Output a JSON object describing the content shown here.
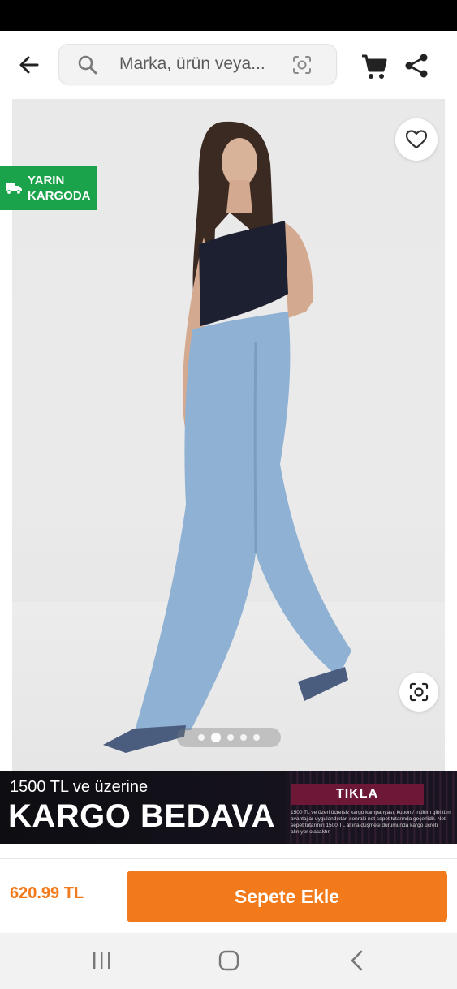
{
  "search": {
    "placeholder": "Marka, ürün veya..."
  },
  "badges": {
    "cargo_line1": "YARIN",
    "cargo_line2": "KARGODA"
  },
  "gallery": {
    "image_count": 5,
    "active_index": 2
  },
  "banner": {
    "line1": "1500 TL ve üzerine",
    "line2": "KARGO BEDAVA",
    "cta": "TIKLA",
    "fine_print": "1500 TL ve üzeri ücretsiz kargo kampanyası, kupon / indirim gibi tüm avantajlar uygulandıktan sonraki net sepet tutarında geçerlidir. Net sepet tutarının 1500 TL altına düşmesi durumunda kargo ücreti alınıyor olacaktır."
  },
  "purchase": {
    "price": "620.99 TL",
    "add_to_cart": "Sepete Ekle"
  },
  "colors": {
    "accent": "#f27a1a",
    "cargo_badge": "#1aa34a",
    "banner_cta": "#6e1838"
  }
}
